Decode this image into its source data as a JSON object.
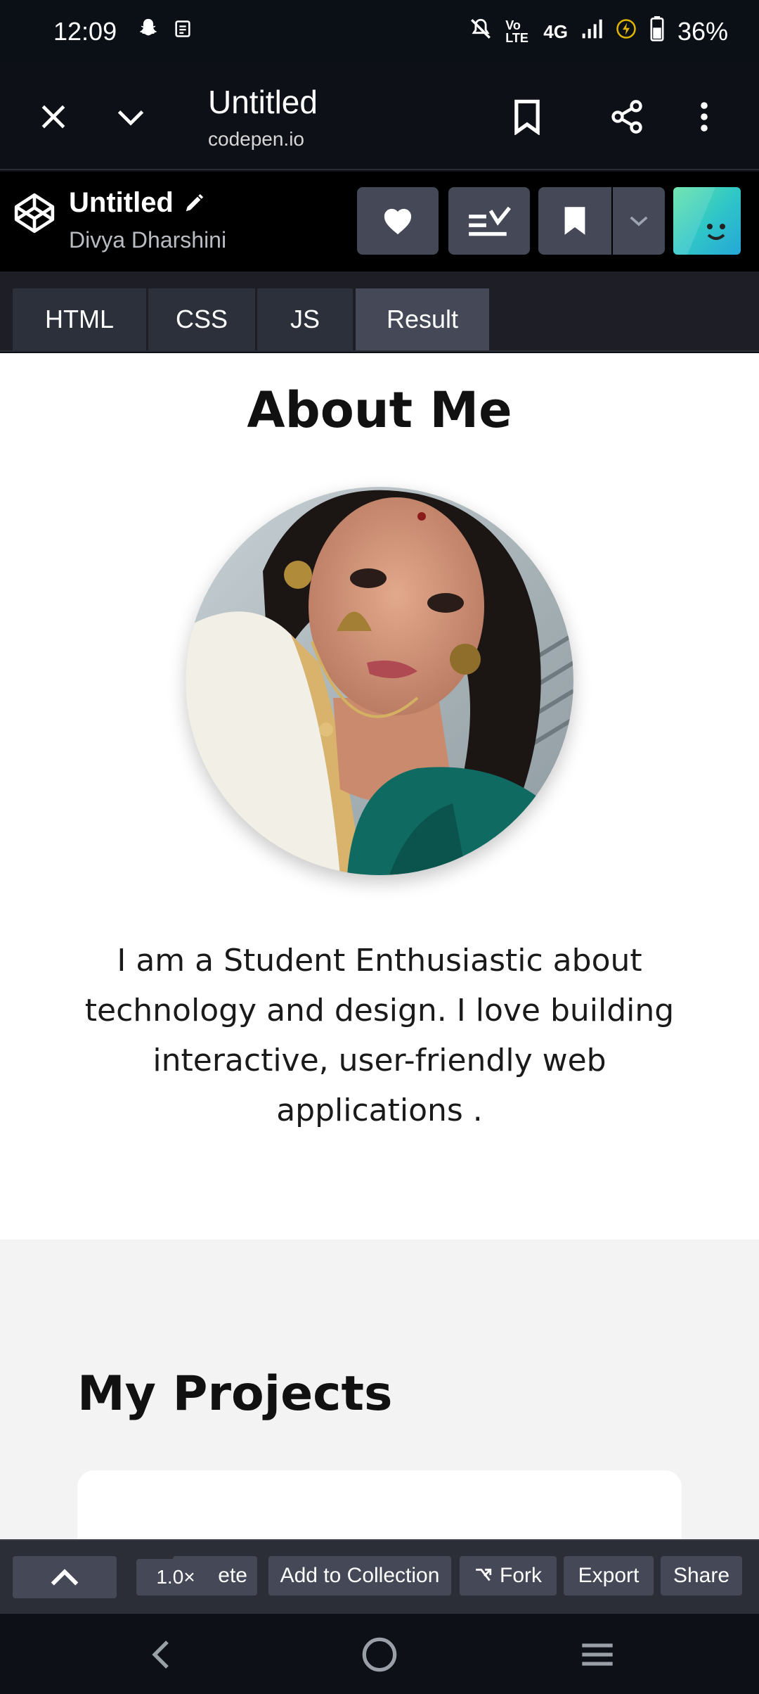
{
  "status_bar": {
    "time": "12:09",
    "network_label": "4G",
    "volte_label": "Vo LTE",
    "battery_percent": "36%"
  },
  "browser": {
    "title": "Untitled",
    "domain": "codepen.io"
  },
  "codepen": {
    "pen_title": "Untitled",
    "author": "Divya Dharshini",
    "tabs": [
      "HTML",
      "CSS",
      "JS",
      "Result"
    ],
    "active_tab": "Result"
  },
  "result": {
    "heading": "About Me",
    "bio_lines": [
      "I am a Student Enthusiastic about",
      "technology and design. I love building",
      "interactive, user-friendly web",
      "applications ."
    ],
    "projects_heading": "My Projects"
  },
  "footer": {
    "zoom": "1.0×",
    "delete_partial": "ete",
    "add_to_collection": "Add to Collection",
    "fork": "Fork",
    "export": "Export",
    "share": "Share"
  },
  "colors": {
    "codepen_button": "#444857",
    "dark_bg": "#0d1117",
    "result_bg": "#ffffff",
    "projects_bg": "#f3f3f3"
  }
}
